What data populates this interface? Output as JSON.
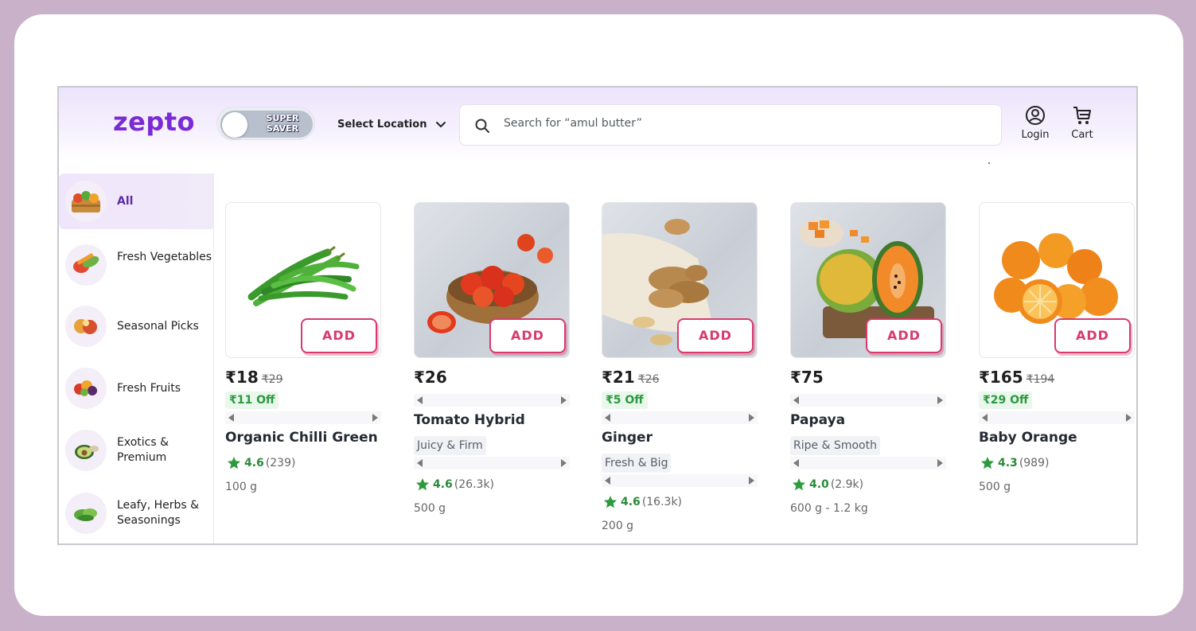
{
  "header": {
    "logo": "zepto",
    "super_saver": [
      "SUPER",
      "SAVER"
    ],
    "location_label": "Select Location",
    "search_placeholder": "Search for “amul butter”",
    "login_label": "Login",
    "cart_label": "Cart"
  },
  "colors": {
    "brand": "#7b2bd4",
    "add_button": "#d93a6b",
    "discount_green": "#2a9a3e"
  },
  "sidebar": {
    "items": [
      {
        "label": "All",
        "icon": "grocery-basket-icon",
        "active": true
      },
      {
        "label": "Fresh Vegetables",
        "icon": "vegetables-icon",
        "active": false
      },
      {
        "label": "Seasonal Picks",
        "icon": "seasonal-fruit-icon",
        "active": false
      },
      {
        "label": "Fresh Fruits",
        "icon": "fruits-icon",
        "active": false
      },
      {
        "label": "Exotics & Premium",
        "icon": "avocado-icon",
        "active": false
      },
      {
        "label": "Leafy, Herbs & Seasonings",
        "icon": "leafy-greens-icon",
        "active": false
      }
    ]
  },
  "products": [
    {
      "name": "Organic Chilli Green",
      "price": "₹18",
      "mrp": "₹29",
      "discount": "₹11 Off",
      "tag": "",
      "rating": "4.6",
      "rating_count": "(239)",
      "quantity": "100 g",
      "add_label": "ADD"
    },
    {
      "name": "Tomato Hybrid",
      "price": "₹26",
      "mrp": "",
      "discount": "",
      "tag": "Juicy & Firm",
      "rating": "4.6",
      "rating_count": "(26.3k)",
      "quantity": "500 g",
      "add_label": "ADD"
    },
    {
      "name": "Ginger",
      "price": "₹21",
      "mrp": "₹26",
      "discount": "₹5 Off",
      "tag": "Fresh & Big",
      "rating": "4.6",
      "rating_count": "(16.3k)",
      "quantity": "200 g",
      "add_label": "ADD"
    },
    {
      "name": "Papaya",
      "price": "₹75",
      "mrp": "",
      "discount": "",
      "tag": "Ripe & Smooth",
      "rating": "4.0",
      "rating_count": "(2.9k)",
      "quantity": "600 g - 1.2 kg",
      "add_label": "ADD"
    },
    {
      "name": "Baby Orange",
      "price": "₹165",
      "mrp": "₹194",
      "discount": "₹29 Off",
      "tag": "",
      "rating": "4.3",
      "rating_count": "(989)",
      "quantity": "500 g",
      "add_label": "ADD"
    }
  ]
}
